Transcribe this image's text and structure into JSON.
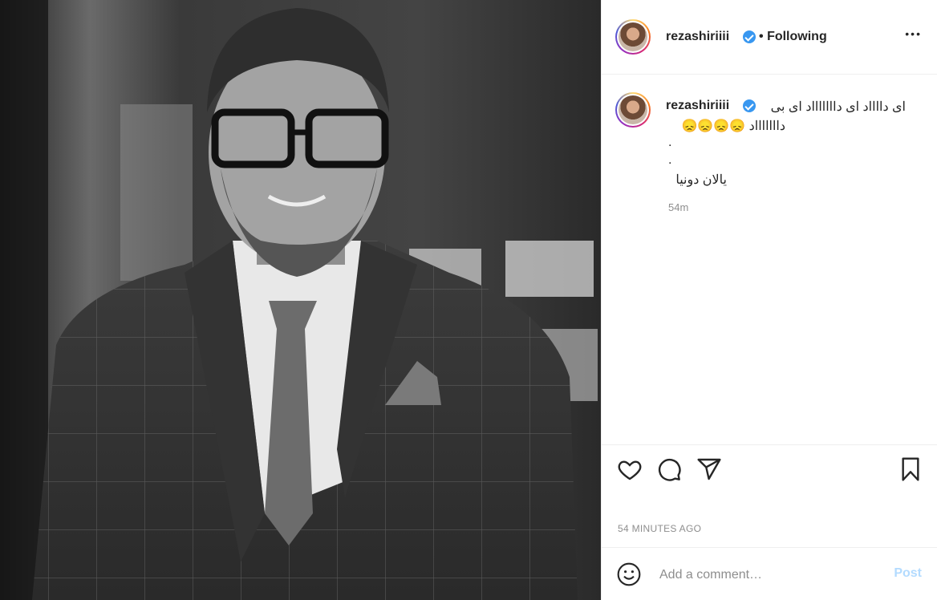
{
  "post": {
    "username": "rezashiriiii",
    "follow_status": "Following",
    "separator": "•",
    "more_label": "•••",
    "caption": {
      "line1": "ای دااااد ای داااااااد ای بی",
      "line2": "داااااااد 😞😞😞😞",
      "line3": ".",
      "line4": ".",
      "line5": "یالان دونیا"
    },
    "caption_time": "54m",
    "posted_ago": "54 MINUTES AGO"
  },
  "actions": {
    "like": "heart-icon",
    "comment": "comment-icon",
    "share": "send-icon",
    "save": "bookmark-icon"
  },
  "comment_box": {
    "placeholder": "Add a comment…",
    "post_label": "Post"
  }
}
